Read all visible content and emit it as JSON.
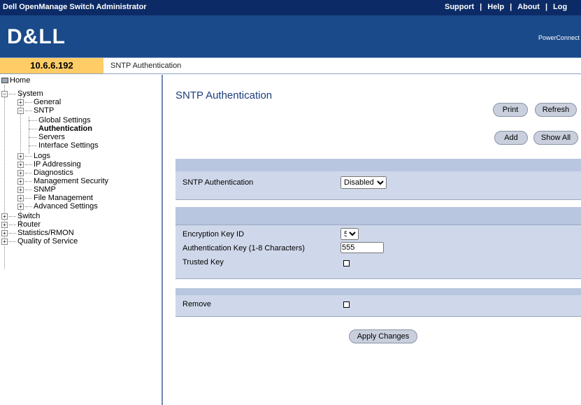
{
  "app": {
    "title": "Dell OpenManage Switch Administrator",
    "links": [
      "Support",
      "Help",
      "About",
      "Log"
    ],
    "logo": "D&LL",
    "banner_right": "PowerConnect"
  },
  "infobar": {
    "ip": "10.6.6.192",
    "breadcrumb": "SNTP Authentication"
  },
  "tree": {
    "home": "Home",
    "system": "System",
    "general": "General",
    "sntp": "SNTP",
    "global_settings": "Global Settings",
    "authentication": "Authentication",
    "servers": "Servers",
    "interface_settings": "Interface Settings",
    "logs": "Logs",
    "ip_addressing": "IP Addressing",
    "diagnostics": "Diagnostics",
    "management_security": "Management Security",
    "snmp": "SNMP",
    "file_management": "File Management",
    "advanced_settings": "Advanced Settings",
    "switch": "Switch",
    "router": "Router",
    "statistics": "Statistics/RMON",
    "qos": "Quality of Service"
  },
  "main": {
    "title": "SNTP Authentication",
    "print_label": "Print",
    "refresh_label": "Refresh",
    "add_label": "Add",
    "show_all_label": "Show All",
    "sntp_auth_label": "SNTP Authentication",
    "sntp_auth_value": "Disabled",
    "key_id_label": "Encryption Key ID",
    "key_id_value": "5",
    "auth_key_label": "Authentication Key (1-8 Characters)",
    "auth_key_value": "555",
    "trusted_key_label": "Trusted Key",
    "remove_label": "Remove",
    "apply_label": "Apply Changes"
  }
}
